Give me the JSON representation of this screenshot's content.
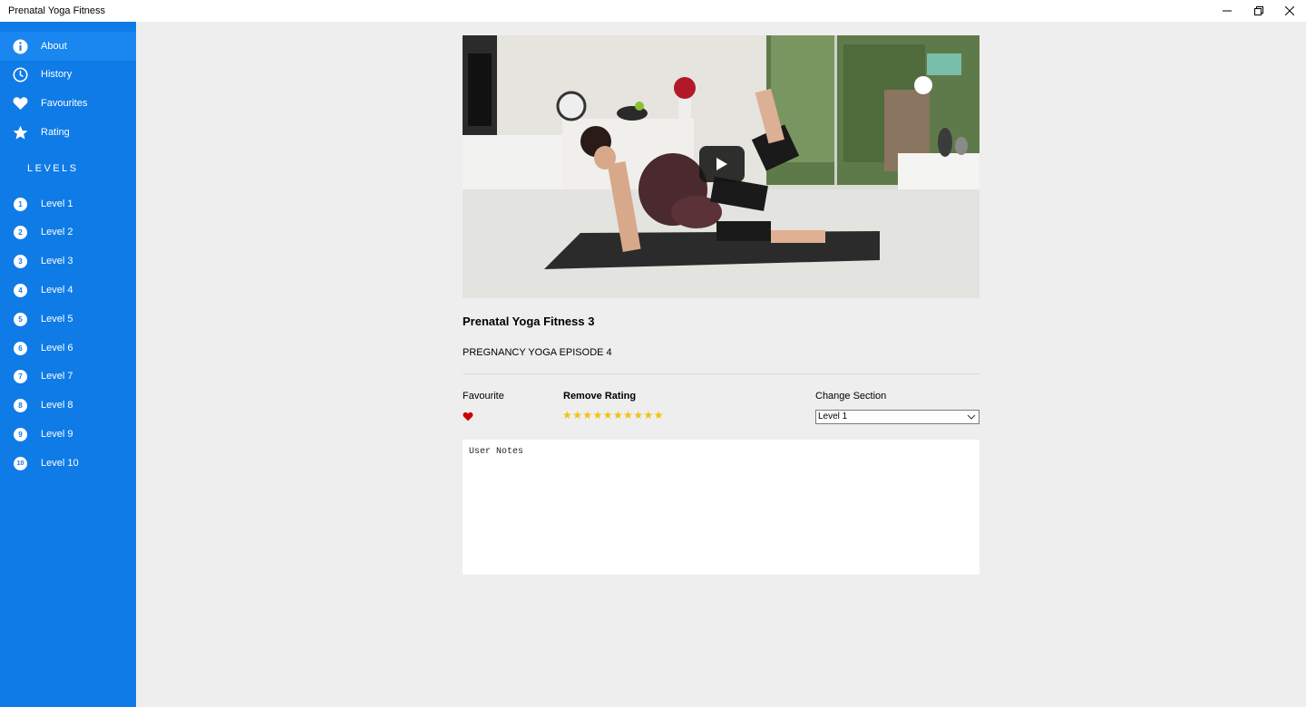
{
  "window": {
    "title": "Prenatal Yoga Fitness",
    "minimize_icon": "minimize-icon",
    "maximize_icon": "restore-icon",
    "close_icon": "close-icon"
  },
  "sidebar": {
    "bg_color": "#0f7be7",
    "items": [
      {
        "label": "About",
        "icon": "info-icon"
      },
      {
        "label": "History",
        "icon": "clock-icon"
      },
      {
        "label": "Favourites",
        "icon": "heart-icon"
      },
      {
        "label": "Rating",
        "icon": "star-icon"
      }
    ],
    "levels_heading": "LEVELS",
    "levels": [
      {
        "num": "1",
        "label": "Level 1"
      },
      {
        "num": "2",
        "label": "Level 2"
      },
      {
        "num": "3",
        "label": "Level 3"
      },
      {
        "num": "4",
        "label": "Level 4"
      },
      {
        "num": "5",
        "label": "Level 5"
      },
      {
        "num": "6",
        "label": "Level 6"
      },
      {
        "num": "7",
        "label": "Level 7"
      },
      {
        "num": "8",
        "label": "Level 8"
      },
      {
        "num": "9",
        "label": "Level 9"
      },
      {
        "num": "10",
        "label": "Level 10"
      }
    ]
  },
  "video": {
    "title": "Prenatal Yoga Fitness 3",
    "subtitle": "PREGNANCY YOGA EPISODE 4",
    "play_icon": "play-icon"
  },
  "controls": {
    "favourite_label": "Favourite",
    "favourite_icon": "heart-icon",
    "favourite_color": "#cc0000",
    "rating_label": "Remove Rating",
    "rating_value": 10,
    "rating_max": 10,
    "star_color": "#f2c20d",
    "section_label": "Change Section",
    "section_selected": "Level 1"
  },
  "notes": {
    "placeholder": "User Notes"
  }
}
